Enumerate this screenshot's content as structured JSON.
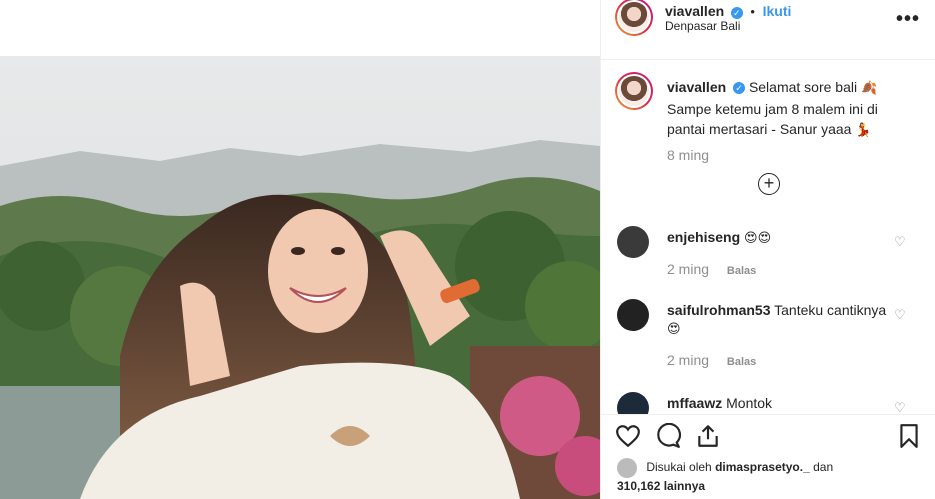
{
  "post": {
    "username": "viavallen",
    "verified_mark": "✓",
    "separator": "•",
    "follow_label": "Ikuti",
    "location": "Denpasar Bali",
    "more_label": "•••",
    "caption_line1": "Selamat sore bali",
    "caption_emoji1": "🍂",
    "caption_line2": "Sampe ketemu jam 8 malem ini di pantai mertasari - Sanur yaaa",
    "caption_emoji2": "💃",
    "caption_time": "8 ming",
    "load_more_icon": "plus-circle-icon"
  },
  "comments": [
    {
      "username": "enjehiseng",
      "text": "",
      "emoji": "😍😍",
      "time": "2 ming",
      "reply": "Balas"
    },
    {
      "username": "saifulrohman53",
      "text": "Tanteku cantiknya",
      "emoji": "😍",
      "time": "2 ming",
      "reply": "Balas"
    },
    {
      "username": "mffaawz",
      "text": "Montok",
      "emoji": "",
      "time": "",
      "reply": ""
    }
  ],
  "actions": {
    "like_icon": "heart-icon",
    "comment_icon": "comment-icon",
    "share_icon": "share-icon",
    "save_icon": "bookmark-icon"
  },
  "likes": {
    "prefix": "Disukai oleh",
    "user": "dimasprasetyo._",
    "suffix": "dan",
    "count": "310,162 lainnya"
  },
  "colors": {
    "link": "#3897f0",
    "muted": "#8e8e8e",
    "text": "#262626"
  }
}
